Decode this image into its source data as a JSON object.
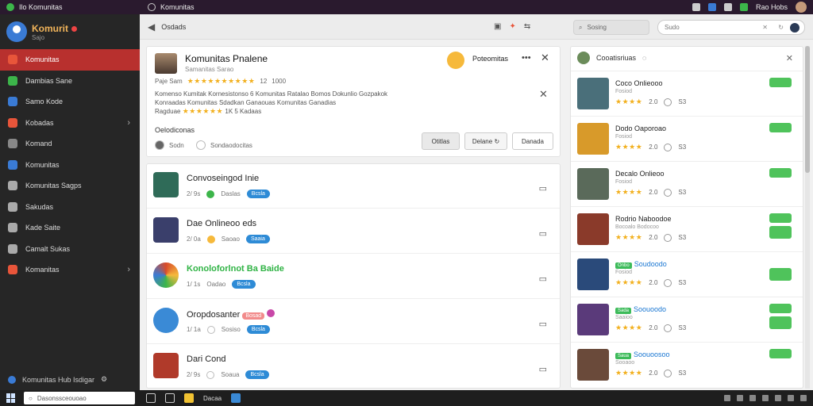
{
  "topbar": {
    "app": "Ilo Komunitas",
    "title": "Komunitas",
    "user": "Rao Hobs"
  },
  "sidebar": {
    "brand": "Komurit",
    "brand_sub": "Sajo",
    "items": [
      {
        "label": "Komunitas",
        "color": "#e8553a"
      },
      {
        "label": "Dambias Sane",
        "color": "#3cb54a"
      },
      {
        "label": "Samo Kode",
        "color": "#3a7bd5"
      },
      {
        "label": "Kobadas",
        "color": "#e8553a"
      },
      {
        "label": "Komand",
        "color": "#888888"
      },
      {
        "label": "Komunitas",
        "color": "#3a7bd5"
      },
      {
        "label": "Komunitas Sagps",
        "color": "#aaaaaa"
      },
      {
        "label": "Sakudas",
        "color": "#aaaaaa"
      },
      {
        "label": "Kade Saite",
        "color": "#aaaaaa"
      },
      {
        "label": "Camalt Sukas",
        "color": "#aaaaaa"
      },
      {
        "label": "Komanitas",
        "color": "#e8553a"
      }
    ],
    "footer": "Komunitas Hub Isdigar"
  },
  "toolbar": {
    "crumb": "Osdads",
    "search_placeholder": "Sosing",
    "search2_placeholder": "Sudo"
  },
  "profile": {
    "title": "Komunitas Pnalene",
    "subtitle": "Samanitas Sarao",
    "rating_label": "Paje Sam",
    "rating_num": "12",
    "rating_count": "1000",
    "desc1": "Komenso Kumitak Kornesistonso 6 Komunitas Ratalao Bomos Dokunlio Gozpakok",
    "desc2": "Konraadas Komunitas Sdadkan Ganaouas Komunitas Ganadias",
    "desc3_label": "Ragduae",
    "desc3_extra": "1K 5 Kadaas",
    "react_label": "Poteomitas",
    "section": "Oelodiconas",
    "opt1": "Sodn",
    "opt2": "Sondaodocitas",
    "btn1": "Otitlas",
    "btn2": "Delane",
    "btn3": "Danada"
  },
  "list": [
    {
      "title": "Convoseingod Inie",
      "m1": "2/ 9s",
      "m2": "Daslas",
      "badge": "Bcsla",
      "thumb": "#2f6b58"
    },
    {
      "title": "Dae Onlineoo eds",
      "m1": "2/ 0a",
      "m2": "Saoao",
      "badge": "Saaia",
      "thumb": "#3a3f6b"
    },
    {
      "title": "Konoloforlnot Ba Baide",
      "m1": "1/ 1s",
      "m2": "Oadao",
      "badge": "Bcsla",
      "thumb": "#d84a2a",
      "green": true
    },
    {
      "title": "Oropdosanter",
      "m1": "1/ 1a",
      "m2": "Sosiso",
      "badge": "Bcsla",
      "thumb": "#3a8ad6",
      "pink": "Bosad"
    },
    {
      "title": "Dari Cond",
      "m1": "2/ 9s",
      "m2": "Soaua",
      "badge": "Bcsla",
      "thumb": "#b03a2a"
    }
  ],
  "right": {
    "header": "Cooatisriuas",
    "items": [
      {
        "title": "Coco Onlieooo",
        "sub": "Fosiod",
        "rate": "2.0",
        "cnt": "S3",
        "thumb": "#4a6f7a"
      },
      {
        "title": "Dodo Oaporoao",
        "sub": "Fosiod",
        "rate": "2.0",
        "cnt": "S3",
        "thumb": "#d89a2a"
      },
      {
        "title": "Decalo Onlieoo",
        "sub": "Fosiod",
        "rate": "2.0",
        "cnt": "S3",
        "thumb": "#5a6a5a"
      },
      {
        "title": "Rodrio Naboodoe",
        "sub": "Bocoalo Bodocoo",
        "rate": "2.0",
        "cnt": "S3",
        "thumb": "#8a3a2a"
      },
      {
        "title": "Soudoodo",
        "sub": "Fosiod",
        "rate": "2.0",
        "cnt": "S3",
        "thumb": "#2a4a7a",
        "tag": "Onbo"
      },
      {
        "title": "Soouoodo",
        "sub": "Saaioo",
        "rate": "2.0",
        "cnt": "S3",
        "thumb": "#5a3a7a",
        "tag": "Sada"
      },
      {
        "title": "Soouoosoo",
        "sub": "Sooaoo",
        "rate": "2.0",
        "cnt": "S3",
        "thumb": "#6a4a3a",
        "tag": "Saua"
      }
    ]
  },
  "taskbar": {
    "search": "Dasonssceouoao",
    "app_label": "Dacaa"
  }
}
